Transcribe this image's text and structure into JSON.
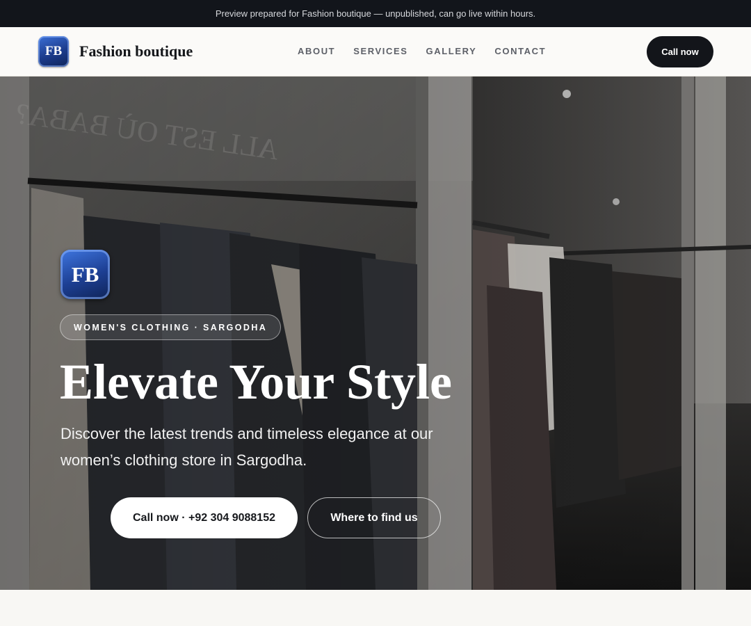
{
  "banner": {
    "text": "Preview prepared for Fashion boutique — unpublished, can go live within hours."
  },
  "header": {
    "logo_initials": "FB",
    "brand_name": "Fashion boutique",
    "nav": [
      {
        "label": "ABOUT"
      },
      {
        "label": "SERVICES"
      },
      {
        "label": "GALLERY"
      },
      {
        "label": "CONTACT"
      }
    ],
    "cta_label": "Call now"
  },
  "hero": {
    "logo_initials": "FB",
    "tag": "WOMEN'S CLOTHING · SARGODHA",
    "headline": "Elevate Your Style",
    "subtitle": "Discover the latest trends and timeless elegance at our women’s clothing store in Sargodha.",
    "primary_button": "Call now · +92 304 9088152",
    "secondary_button": "Where to find us"
  },
  "colors": {
    "accent_dark": "#13151a",
    "logo_blue": "#1d3f93",
    "page_background": "#f8f7f4"
  }
}
